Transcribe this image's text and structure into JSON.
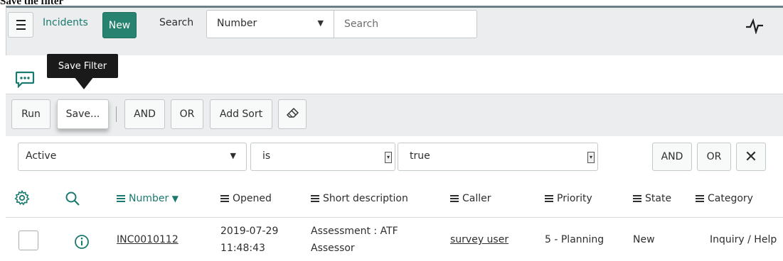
{
  "caption": "Save the filter",
  "nav": {
    "list_title": "Incidents",
    "new_label": "New",
    "search_label": "Search",
    "search_field_selected": "Number",
    "search_placeholder": "Search"
  },
  "tooltip": {
    "text": "Save Filter"
  },
  "filter_toolbar": {
    "run_label": "Run",
    "save_label": "Save...",
    "and_label": "AND",
    "or_label": "OR",
    "add_sort_label": "Add Sort"
  },
  "condition": {
    "field": "Active",
    "operator": "is",
    "value": "true",
    "and_label": "AND",
    "or_label": "OR",
    "remove_label": "✕"
  },
  "columns": [
    {
      "label": "Number",
      "sorted": "descending"
    },
    {
      "label": "Opened"
    },
    {
      "label": "Short description"
    },
    {
      "label": "Caller"
    },
    {
      "label": "Priority"
    },
    {
      "label": "State"
    },
    {
      "label": "Category"
    }
  ],
  "rows": [
    {
      "number": "INC0010112",
      "opened_date": "2019-07-29",
      "opened_time": "11:48:43",
      "short_description_1": "Assessment : ATF",
      "short_description_2": "Assessor",
      "caller": "survey user",
      "priority": "5 - Planning",
      "state": "New",
      "category": "Inquiry / Help"
    }
  ],
  "colors": {
    "accent": "#27826f",
    "link": "#1b7a6f",
    "toolbar_bg": "#ebedee",
    "tooltip_bg": "#1a1a1a"
  },
  "icons": [
    "hamburger-icon",
    "pulse-icon",
    "chat-icon",
    "eraser-icon",
    "gear-icon",
    "search-icon",
    "info-icon",
    "sort-down-icon",
    "dropdown-arrow-icon"
  ]
}
